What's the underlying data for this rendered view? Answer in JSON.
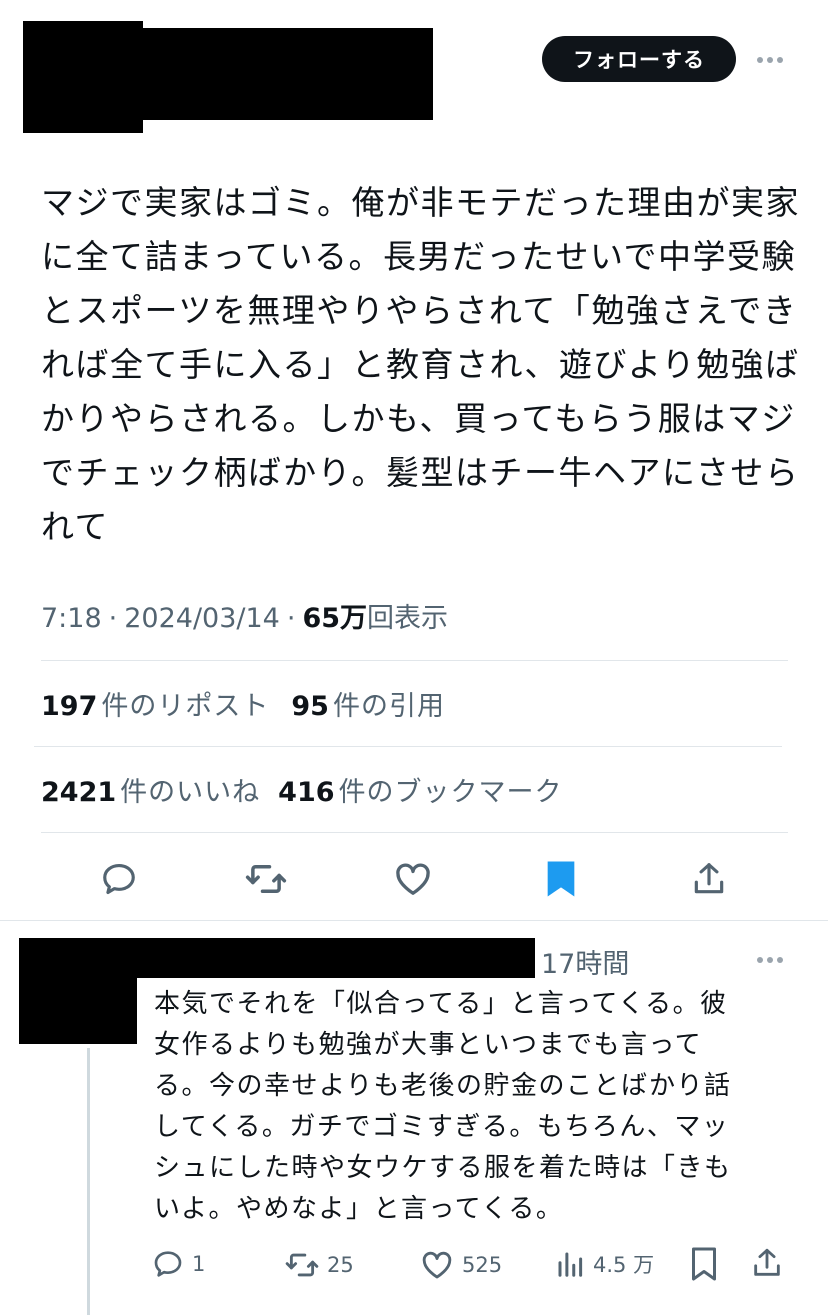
{
  "tweet": {
    "follow_label": "フォローする",
    "text_lines": [
      "マジで実家はゴミ。俺が非モテだった理由が実家",
      "に全て詰まっている。長男だったせいで中学受験",
      "とスポーツを無理やりやらされて「勉強さえでき",
      "れば全て手に入る」と教育され、遊びより勉強ば",
      "かりやらされる。しかも、買ってもらう服はマジ",
      "でチェック柄ばかり。髪型はチー牛ヘアにさせら",
      "れて"
    ],
    "time": "7:18",
    "sep": "·",
    "date": "2024/03/14",
    "views_num": "65万",
    "views_label": "回表示"
  },
  "stats": {
    "reposts_num": "197",
    "reposts_label": "件のリポスト",
    "quotes_num": "95",
    "quotes_label": "件の引用",
    "likes_num": "2421",
    "likes_label": "件のいいね",
    "bookmarks_num": "416",
    "bookmarks_label": "件のブックマーク"
  },
  "actions": {
    "icons": [
      "reply-icon",
      "retweet-icon",
      "heart-icon",
      "bookmark-icon",
      "share-icon"
    ],
    "bookmark_color": "#1d9bf0"
  },
  "reply": {
    "time": "17時間",
    "text_lines": [
      "本気でそれを「似合ってる」と言ってくる。彼",
      "女作るよりも勉強が大事といつまでも言って",
      "る。今の幸せよりも老後の貯金のことばかり話",
      "してくる。ガチでゴミすぎる。もちろん、マッ",
      "シュにした時や女ウケする服を着た時は「きも",
      "いよ。やめなよ」と言ってくる。"
    ],
    "reply_count": "1",
    "retweet_count": "25",
    "like_count": "525",
    "view_count": "4.5 万"
  },
  "colors": {
    "text": "#0f1419",
    "secondary": "#536471",
    "accent": "#1d9bf0",
    "divider": "#e1e6ea"
  }
}
